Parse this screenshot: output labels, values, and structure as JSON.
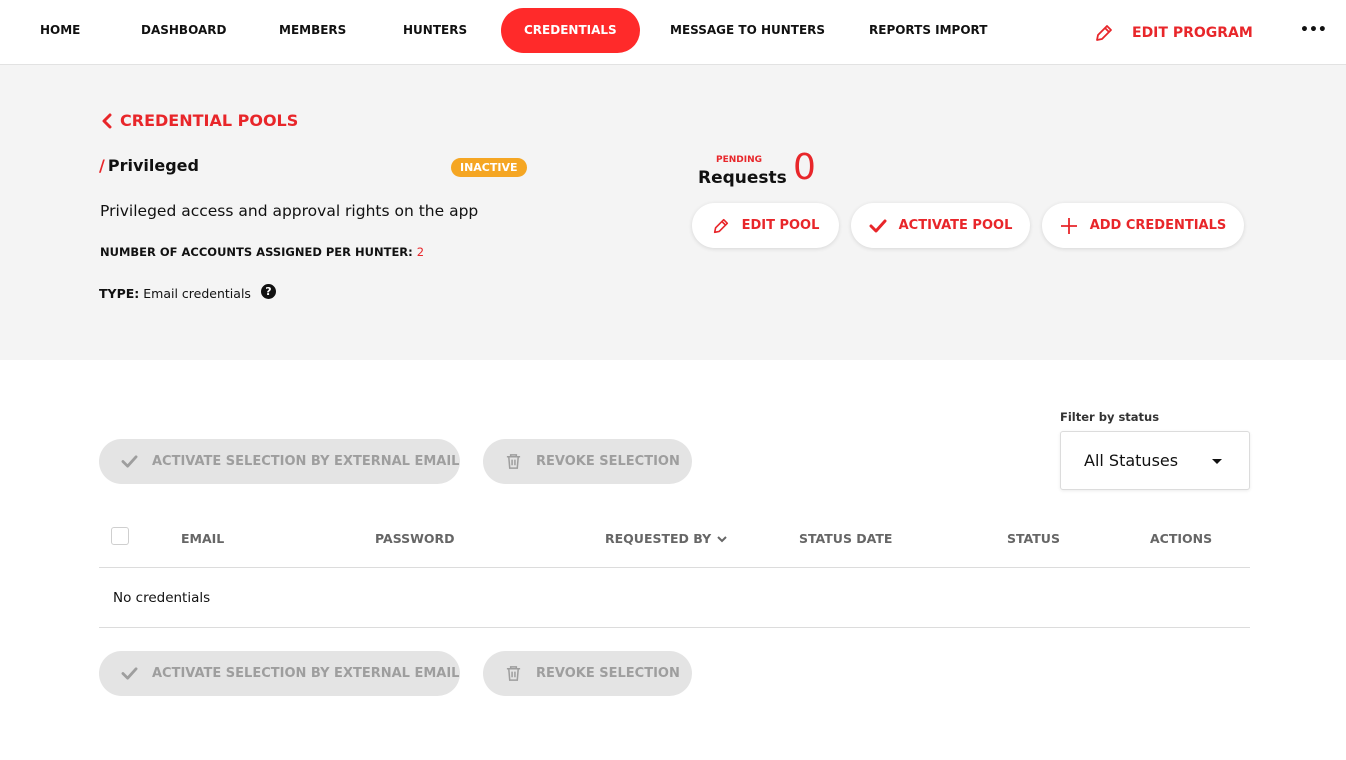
{
  "nav": {
    "items": [
      {
        "label": "HOME"
      },
      {
        "label": "DASHBOARD"
      },
      {
        "label": "MEMBERS"
      },
      {
        "label": "HUNTERS"
      },
      {
        "label": "CREDENTIALS",
        "active": true
      },
      {
        "label": "MESSAGE TO HUNTERS"
      },
      {
        "label": "REPORTS IMPORT"
      }
    ],
    "edit_program_label": "EDIT PROGRAM",
    "more_label": "•••"
  },
  "pool": {
    "back_label": "CREDENTIAL POOLS",
    "slash": "/",
    "name": "Privileged",
    "status": "INACTIVE",
    "description": "Privileged access and approval rights on the app",
    "accounts_label": "NUMBER OF ACCOUNTS ASSIGNED PER HUNTER:",
    "accounts_value": "2",
    "type_label": "TYPE:",
    "type_value": "Email credentials",
    "help_glyph": "?"
  },
  "requests": {
    "pending_label": "PENDING",
    "label": "Requests",
    "count": "0"
  },
  "actions": {
    "edit_pool": "EDIT POOL",
    "activate_pool": "ACTIVATE POOL",
    "add_credentials": "ADD CREDENTIALS"
  },
  "filter": {
    "label": "Filter by status",
    "value": "All Statuses"
  },
  "bulk": {
    "activate_label": "ACTIVATE SELECTION BY EXTERNAL EMAIL",
    "revoke_label": "REVOKE SELECTION"
  },
  "table": {
    "columns": [
      "EMAIL",
      "PASSWORD",
      "REQUESTED BY",
      "STATUS DATE",
      "STATUS",
      "ACTIONS"
    ],
    "empty_text": "No credentials"
  },
  "colors": {
    "accent": "#e8262a",
    "nav_active": "#ff2a2a",
    "badge_inactive": "#f5a623",
    "panel_bg": "#f4f4f4",
    "disabled_btn": "#e4e4e4"
  },
  "icons": [
    "pencil-icon",
    "chevron-left-icon",
    "help-circle-icon",
    "check-icon",
    "plus-icon",
    "trash-icon",
    "caret-down-icon",
    "chevron-down-icon",
    "more-dots-icon"
  ]
}
